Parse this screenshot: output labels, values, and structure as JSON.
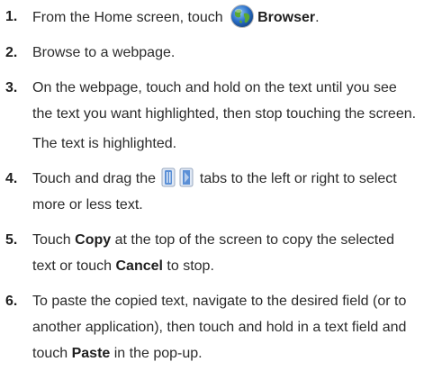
{
  "steps": [
    {
      "number": "1.",
      "text_before": "From the Home screen, touch ",
      "icon": "browser-globe-icon",
      "bold": "Browser",
      "text_after": "."
    },
    {
      "number": "2.",
      "text": "Browse to a webpage."
    },
    {
      "number": "3.",
      "text": "On the webpage, touch and hold on the text until you see the text you want highlighted, then stop touching the screen.",
      "result": "The text is highlighted."
    },
    {
      "number": "4.",
      "text_before": "Touch and drag the ",
      "icons": [
        "left-selection-tab-icon",
        "right-selection-tab-icon"
      ],
      "text_after": " tabs to the left or right to select more or less text."
    },
    {
      "number": "5.",
      "text_1": "Touch ",
      "bold_1": "Copy",
      "text_2": " at the top of the screen to copy the selected text or touch ",
      "bold_2": "Cancel",
      "text_3": " to stop."
    },
    {
      "number": "6.",
      "text_1": "To paste the copied text, navigate to the desired field (or to another application), then touch and hold in a text field and touch ",
      "bold_1": "Paste",
      "text_2": " in the pop-up."
    }
  ],
  "colors": {
    "text": "#2b2b2b",
    "globe_blue": "#2a6fc9",
    "globe_green": "#5aa832",
    "tab_blue": "#5a8fd6"
  }
}
